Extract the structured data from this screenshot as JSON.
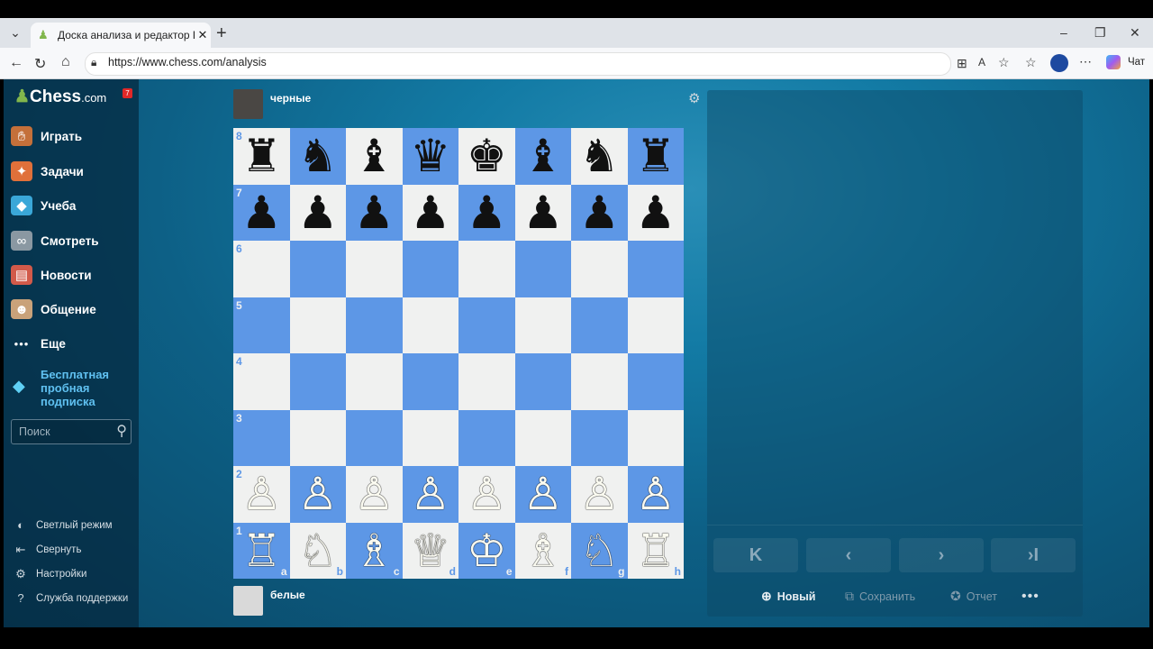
{
  "browser": {
    "tab_title": "Доска анализа и редактор PGN -",
    "url": "https://www.chess.com/analysis",
    "chat_label": "Чат"
  },
  "sidebar": {
    "logo_main": "Chess",
    "logo_domain": ".com",
    "notification_count": "7",
    "items": [
      {
        "label": "Играть",
        "icon": "play-hand-icon",
        "color": "#c4703a"
      },
      {
        "label": "Задачи",
        "icon": "puzzle-icon",
        "color": "#e0703a"
      },
      {
        "label": "Учеба",
        "icon": "learn-cap-icon",
        "color": "#3aa7d8"
      },
      {
        "label": "Смотреть",
        "icon": "binoculars-icon",
        "color": "#b8c4cc"
      },
      {
        "label": "Новости",
        "icon": "news-icon",
        "color": "#d25a4a"
      },
      {
        "label": "Общение",
        "icon": "community-icon",
        "color": "#c9a27a"
      },
      {
        "label": "Еще",
        "icon": "more-dots-icon",
        "color": "#d7dfe5"
      }
    ],
    "trial_label": "Бесплатная пробная подписка",
    "search_placeholder": "Поиск",
    "bottom": {
      "light_mode": "Светлый режим",
      "collapse": "Свернуть",
      "settings": "Настройки",
      "support": "Служба поддержки"
    }
  },
  "board": {
    "top_player": "черные",
    "bottom_player": "белые",
    "ranks": [
      "8",
      "7",
      "6",
      "5",
      "4",
      "3",
      "2",
      "1"
    ],
    "files": [
      "a",
      "b",
      "c",
      "d",
      "e",
      "f",
      "g",
      "h"
    ],
    "position": [
      [
        "♜",
        "♞",
        "♝",
        "♛",
        "♚",
        "♝",
        "♞",
        "♜"
      ],
      [
        "♟",
        "♟",
        "♟",
        "♟",
        "♟",
        "♟",
        "♟",
        "♟"
      ],
      [
        "",
        "",
        "",
        "",
        "",
        "",
        "",
        ""
      ],
      [
        "",
        "",
        "",
        "",
        "",
        "",
        "",
        ""
      ],
      [
        "",
        "",
        "",
        "",
        "",
        "",
        "",
        ""
      ],
      [
        "",
        "",
        "",
        "",
        "",
        "",
        "",
        ""
      ],
      [
        "♙",
        "♙",
        "♙",
        "♙",
        "♙",
        "♙",
        "♙",
        "♙"
      ],
      [
        "♖",
        "♘",
        "♗",
        "♕",
        "♔",
        "♗",
        "♘",
        "♖"
      ]
    ],
    "colors": {
      "light": "#f0f1f0",
      "dark": "#5d97e6"
    }
  },
  "panel": {
    "nav": {
      "first": "K",
      "prev": "‹",
      "next": "›",
      "last": "›I"
    },
    "actions": {
      "new": "Новый",
      "save": "Сохранить",
      "report": "Отчет"
    }
  }
}
